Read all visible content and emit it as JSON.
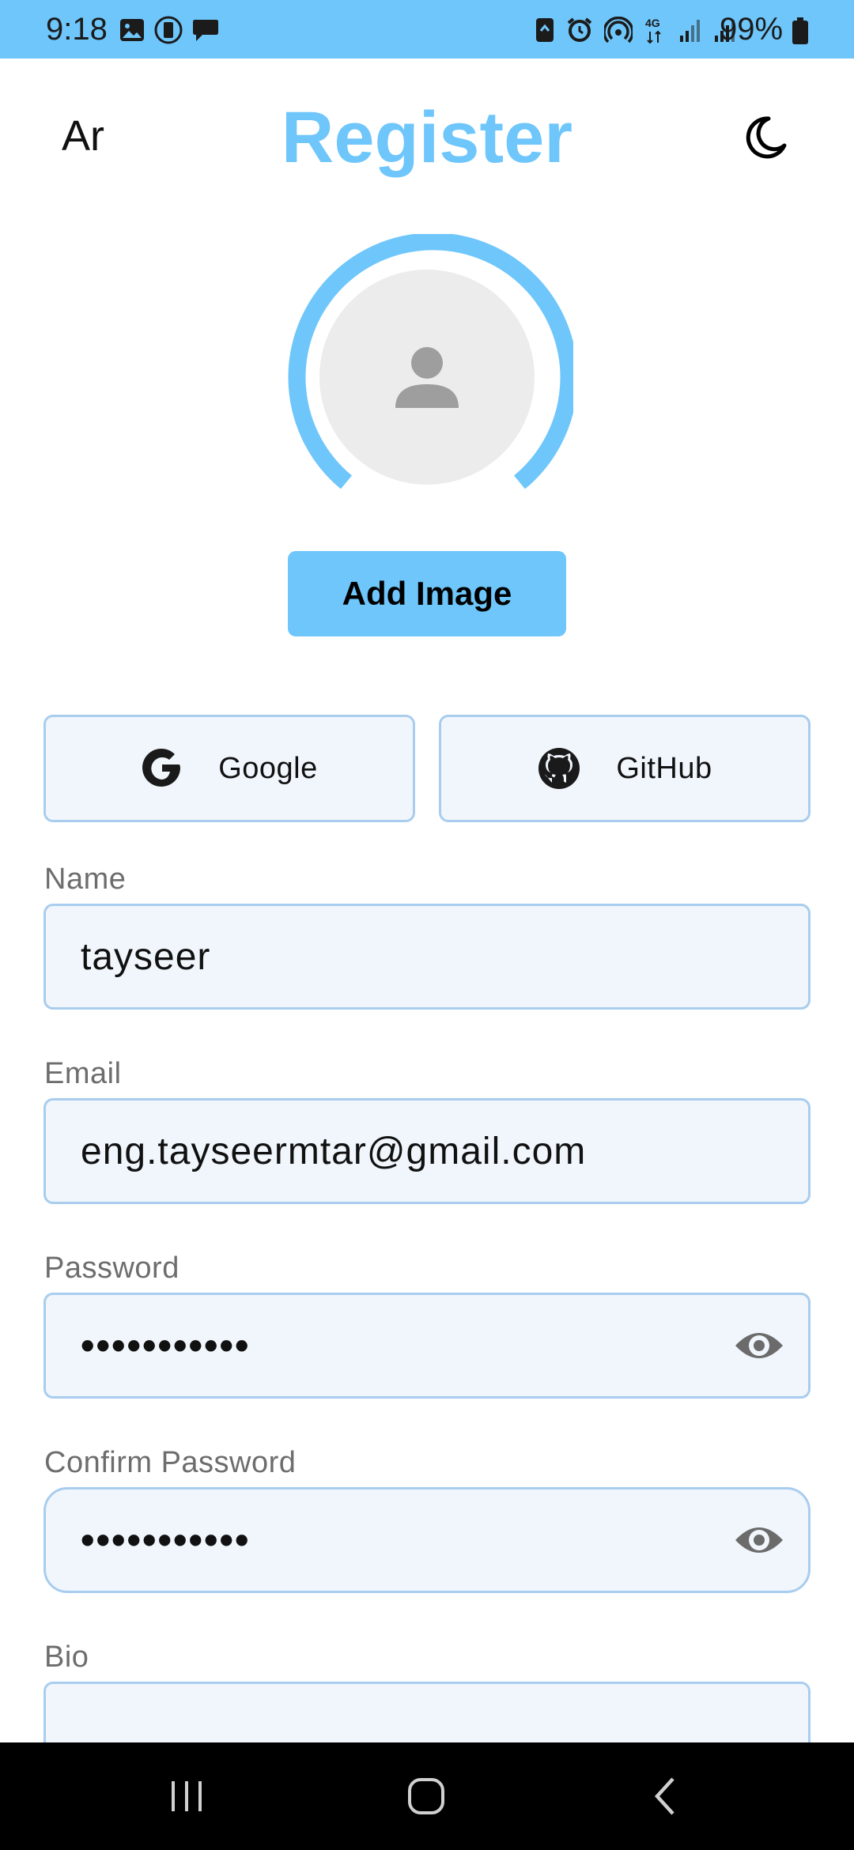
{
  "status_bar": {
    "time": "9:18",
    "battery": "99%",
    "network": "4G"
  },
  "header": {
    "language_toggle": "Ar",
    "title": "Register"
  },
  "avatar": {
    "add_image_label": "Add Image",
    "progress_fraction": 0.78
  },
  "social": {
    "google_label": "Google",
    "github_label": "GitHub"
  },
  "form": {
    "name": {
      "label": "Name",
      "value": "tayseer"
    },
    "email": {
      "label": "Email",
      "value": "eng.tayseermtar@gmail.com"
    },
    "password": {
      "label": "Password",
      "value": "•••••••••••"
    },
    "confirm_password": {
      "label": "Confirm Password",
      "value": "•••••••••••"
    },
    "bio": {
      "label": "Bio",
      "value": ""
    }
  },
  "colors": {
    "accent": "#6ec6fb",
    "field_background": "#f0f6fc",
    "field_border": "#a9cdee",
    "label_gray": "#6d6d6d"
  },
  "icons": {
    "theme": "moon-icon",
    "google": "google-g-icon",
    "github": "github-octocat-icon",
    "password_visibility": "eye-icon"
  }
}
